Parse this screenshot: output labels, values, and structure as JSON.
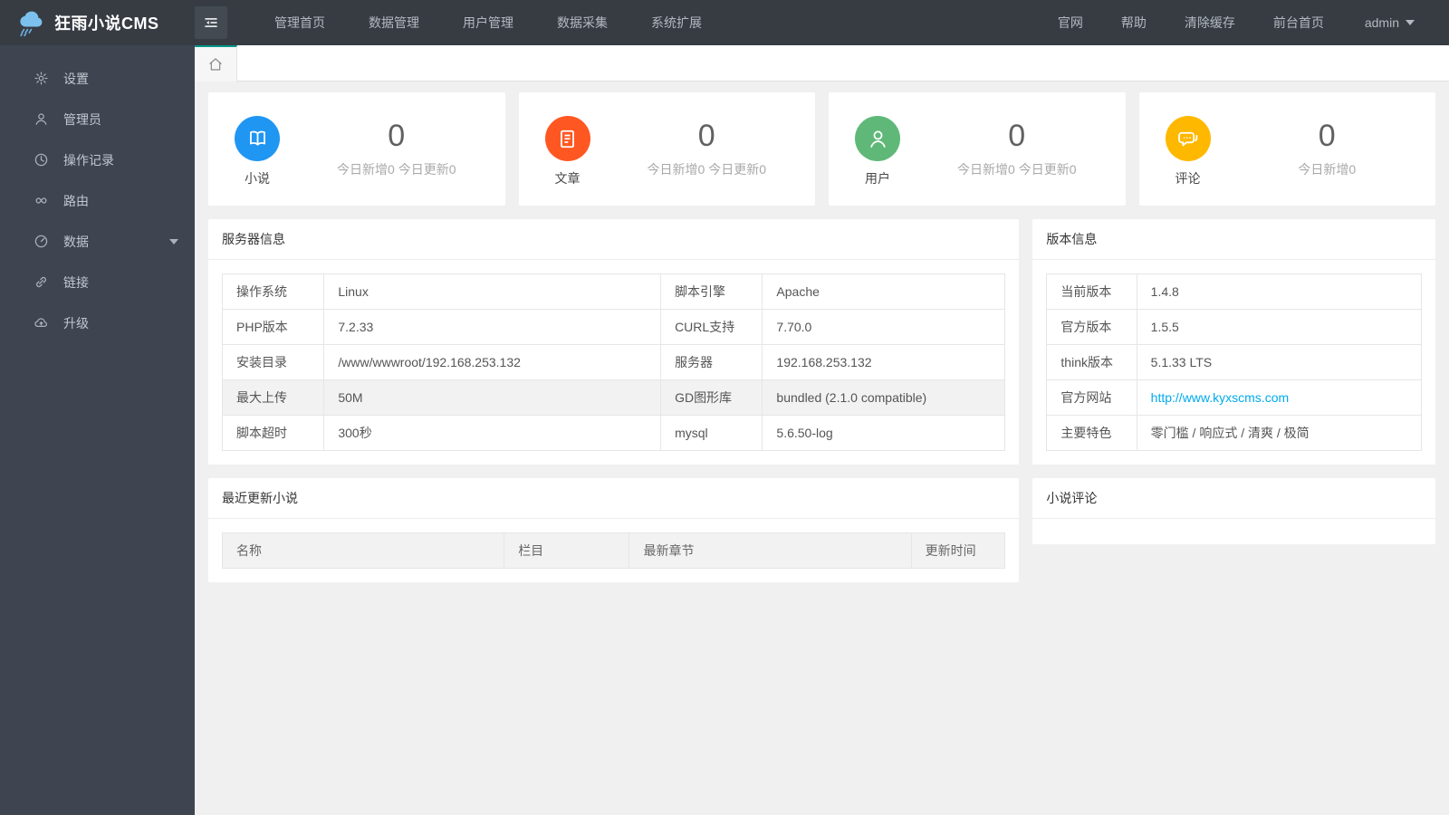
{
  "app": {
    "title": "狂雨小说CMS",
    "logo_icon": "rain-cloud-icon"
  },
  "header": {
    "menu_toggle_icon": "collapse-menu-icon",
    "nav": [
      {
        "label": "管理首页"
      },
      {
        "label": "数据管理"
      },
      {
        "label": "用户管理"
      },
      {
        "label": "数据采集"
      },
      {
        "label": "系统扩展"
      }
    ],
    "quick_links": [
      {
        "label": "官网"
      },
      {
        "label": "帮助"
      },
      {
        "label": "清除缓存"
      },
      {
        "label": "前台首页"
      }
    ],
    "user": {
      "name": "admin",
      "dropdown_icon": "caret-down-icon"
    }
  },
  "tabbar": {
    "tabs": [
      {
        "icon": "home-icon",
        "active": true
      }
    ]
  },
  "sidebar": {
    "items": [
      {
        "label": "设置",
        "icon": "gear-icon"
      },
      {
        "label": "管理员",
        "icon": "admin-user-icon"
      },
      {
        "label": "操作记录",
        "icon": "clock-icon"
      },
      {
        "label": "路由",
        "icon": "route-icon"
      },
      {
        "label": "数据",
        "icon": "gauge-icon",
        "has_children": true,
        "expand_icon": "caret-down-icon"
      },
      {
        "label": "链接",
        "icon": "link-icon"
      },
      {
        "label": "升级",
        "icon": "upgrade-cloud-icon"
      }
    ]
  },
  "stats": [
    {
      "label": "小说",
      "value": "0",
      "caption": "今日新增0 今日更新0",
      "icon": "book-icon",
      "color": "#2096f3"
    },
    {
      "label": "文章",
      "value": "0",
      "caption": "今日新增0 今日更新0",
      "icon": "article-icon",
      "color": "#ff5722"
    },
    {
      "label": "用户",
      "value": "0",
      "caption": "今日新增0 今日更新0",
      "icon": "user-icon",
      "color": "#5fb878"
    },
    {
      "label": "评论",
      "value": "0",
      "caption": "今日新增0",
      "icon": "comment-icon",
      "color": "#ffb800"
    }
  ],
  "server_panel": {
    "title": "服务器信息",
    "rows": [
      [
        "操作系统",
        "Linux",
        "脚本引擎",
        "Apache"
      ],
      [
        "PHP版本",
        "7.2.33",
        "CURL支持",
        "7.70.0"
      ],
      [
        "安装目录",
        "/www/wwwroot/192.168.253.132",
        "服务器",
        "192.168.253.132"
      ],
      [
        "最大上传",
        "50M",
        "GD图形库",
        "bundled (2.1.0 compatible)"
      ],
      [
        "脚本超时",
        "300秒",
        "mysql",
        "5.6.50-log"
      ]
    ]
  },
  "version_panel": {
    "title": "版本信息",
    "rows": [
      {
        "label": "当前版本",
        "value": "1.4.8"
      },
      {
        "label": "官方版本",
        "value": "1.5.5"
      },
      {
        "label": "think版本",
        "value": "5.1.33 LTS"
      },
      {
        "label": "官方网站",
        "value": "http://www.kyxscms.com",
        "is_link": true
      },
      {
        "label": "主要特色",
        "value": "零门槛 / 响应式 / 清爽 / 极简"
      }
    ]
  },
  "recent_panel": {
    "title": "最近更新小说",
    "columns": [
      "名称",
      "栏目",
      "最新章节",
      "更新时间"
    ]
  },
  "comments_panel": {
    "title": "小说评论"
  },
  "colors": {
    "accent": "#009688",
    "link": "#01aaed",
    "stat_novel": "#2096f3",
    "stat_article": "#ff5722",
    "stat_user": "#5fb878",
    "stat_comment": "#ffb800"
  }
}
